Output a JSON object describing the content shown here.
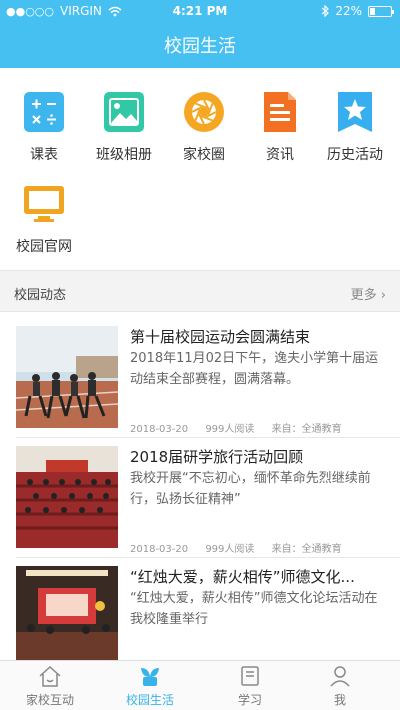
{
  "status": {
    "carrier": "VIRGIN",
    "time": "4:21 PM",
    "battery": "22%"
  },
  "header": {
    "title": "校园生活"
  },
  "shortcuts": [
    {
      "label": "课表",
      "icon": "calculator-icon",
      "color": "#3db6ee"
    },
    {
      "label": "班级相册",
      "icon": "image-icon",
      "color": "#32c7a5"
    },
    {
      "label": "家校圈",
      "icon": "aperture-icon",
      "color": "#f5a623"
    },
    {
      "label": "资讯",
      "icon": "document-icon",
      "color": "#f36f21"
    },
    {
      "label": "历史活动",
      "icon": "star-bookmark-icon",
      "color": "#36aef0"
    },
    {
      "label": "校园官网",
      "icon": "monitor-icon",
      "color": "#f0a420"
    }
  ],
  "section": {
    "title": "校园动态",
    "more": "更多"
  },
  "news": [
    {
      "title": "第十届校园运动会圆满结束",
      "body": "2018年11月02日下午，逸夫小学第十届运动结束全部赛程，圆满落幕。",
      "date": "2018-03-20",
      "reads": "999人阅读",
      "source": "来自：全通教育"
    },
    {
      "title": "2018届研学旅行活动回顾",
      "body": "我校开展“不忘初心，缅怀革命先烈继续前行，弘扬长征精神”",
      "date": "2018-03-20",
      "reads": "999人阅读",
      "source": "来自：全通教育"
    },
    {
      "title": "“红烛大爱，薪火相传”师德文化...",
      "body": "“红烛大爱，薪火相传”师德文化论坛活动在我校隆重举行",
      "date": "",
      "reads": "",
      "source": ""
    }
  ],
  "tabs": [
    {
      "label": "家校互动",
      "active": false
    },
    {
      "label": "校园生活",
      "active": true
    },
    {
      "label": "学习",
      "active": false
    },
    {
      "label": "我",
      "active": false
    }
  ],
  "colors": {
    "primary": "#45c0f0",
    "active_tab": "#37b3ea"
  }
}
